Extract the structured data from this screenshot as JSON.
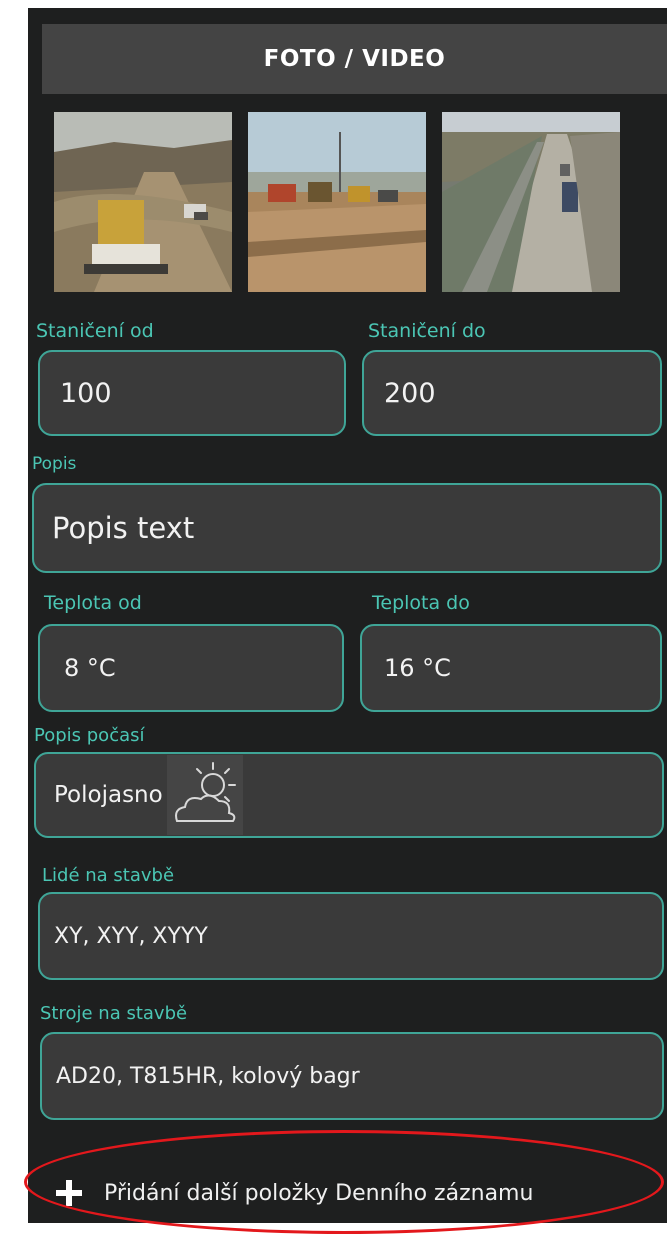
{
  "header": {
    "title": "FOTO / VIDEO"
  },
  "photos": [
    {
      "icon": "photo-road-construction-1"
    },
    {
      "icon": "photo-road-construction-2"
    },
    {
      "icon": "photo-road-construction-3"
    }
  ],
  "form": {
    "station_from": {
      "label": "Staničení od",
      "value": "100"
    },
    "station_to": {
      "label": "Staničení do",
      "value": "200"
    },
    "description": {
      "label": "Popis",
      "value": "Popis text"
    },
    "temp_from": {
      "label": "Teplota od",
      "value": "8 °C"
    },
    "temp_to": {
      "label": "Teplota do",
      "value": "16 °C"
    },
    "weather": {
      "label": "Popis počasí",
      "value": "Polojasno",
      "icon": "partly-cloudy-icon"
    },
    "people": {
      "label": "Lidé na stavbě",
      "value": "XY, XYY, XYYY"
    },
    "machines": {
      "label": "Stroje na stavbě",
      "value": "AD20, T815HR, kolový bagr"
    }
  },
  "add_item": {
    "label": "Přidání další položky Denního záznamu",
    "icon": "plus-icon"
  },
  "colors": {
    "panel_bg": "#1e1f1f",
    "header_bg": "#444444",
    "accent_teal": "#4bc6b4",
    "field_bg": "#3a3a3a",
    "annotation_red": "#e3181c"
  }
}
